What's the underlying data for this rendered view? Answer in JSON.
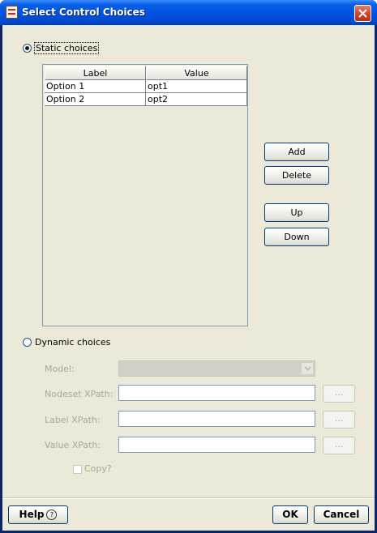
{
  "window": {
    "title": "Select Control Choices"
  },
  "static": {
    "label": "Static choices",
    "selected": true
  },
  "table": {
    "columns": [
      "Label",
      "Value"
    ],
    "rows": [
      {
        "label": "Option 1",
        "value": "opt1"
      },
      {
        "label": "Option 2",
        "value": "opt2"
      }
    ]
  },
  "side_buttons": {
    "add": "Add",
    "delete": "Delete",
    "up": "Up",
    "down": "Down"
  },
  "dynamic": {
    "label": "Dynamic choices",
    "selected": false,
    "model_label": "Model:",
    "model_value": "",
    "nodeset_label": "Nodeset XPath:",
    "nodeset_value": "",
    "label_xpath_label": "Label XPath:",
    "label_xpath_value": "",
    "value_xpath_label": "Value XPath:",
    "value_xpath_value": "",
    "browse": "...",
    "copy_label": "Copy?",
    "copy_checked": false
  },
  "footer": {
    "help": "Help",
    "help_icon": "?",
    "ok": "OK",
    "cancel": "Cancel"
  },
  "colors": {
    "titlebar": "#0054e3",
    "dialog_bg": "#ece9d8",
    "close": "#c9412a"
  }
}
